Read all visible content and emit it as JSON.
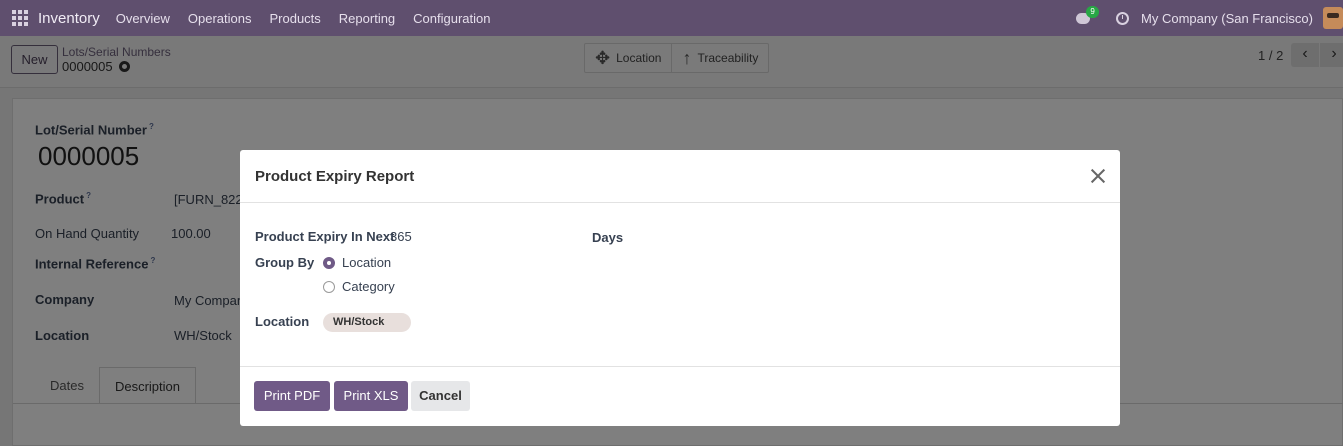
{
  "navbar": {
    "app_name": "Inventory",
    "menu": [
      "Overview",
      "Operations",
      "Products",
      "Reporting",
      "Configuration"
    ],
    "chat_badge": "9",
    "company": "My Company (San Francisco)"
  },
  "control": {
    "new_label": "New",
    "breadcrumb_parent": "Lots/Serial Numbers",
    "breadcrumb_current": "0000005",
    "smart_buttons": [
      {
        "label": "Location",
        "icon": "move-arrows-icon"
      },
      {
        "label": "Traceability",
        "icon": "arrow-up-icon"
      }
    ],
    "pager": "1 / 2"
  },
  "form": {
    "lot_label": "Lot/Serial Number",
    "lot_value": "0000005",
    "product_label": "Product",
    "product_value": "[FURN_822",
    "onhand_label": "On Hand Quantity",
    "onhand_value": "100.00",
    "internal_ref_label": "Internal Reference",
    "company_label": "Company",
    "company_value": "My Compan",
    "location_label": "Location",
    "location_value": "WH/Stock",
    "help_mark": "?",
    "tabs": [
      "Dates",
      "Description"
    ]
  },
  "modal": {
    "title": "Product Expiry Report",
    "expiry_label": "Product Expiry In Next",
    "expiry_value": "365",
    "days_label": "Days",
    "group_by_label": "Group By",
    "group_options": [
      {
        "label": "Location",
        "checked": true
      },
      {
        "label": "Category",
        "checked": false
      }
    ],
    "location_label": "Location",
    "location_tag": "WH/Stock",
    "buttons": {
      "print_pdf": "Print PDF",
      "print_xls": "Print XLS",
      "cancel": "Cancel"
    }
  },
  "colors": {
    "navbar": "#5f4f6e",
    "primary": "#705a87"
  }
}
